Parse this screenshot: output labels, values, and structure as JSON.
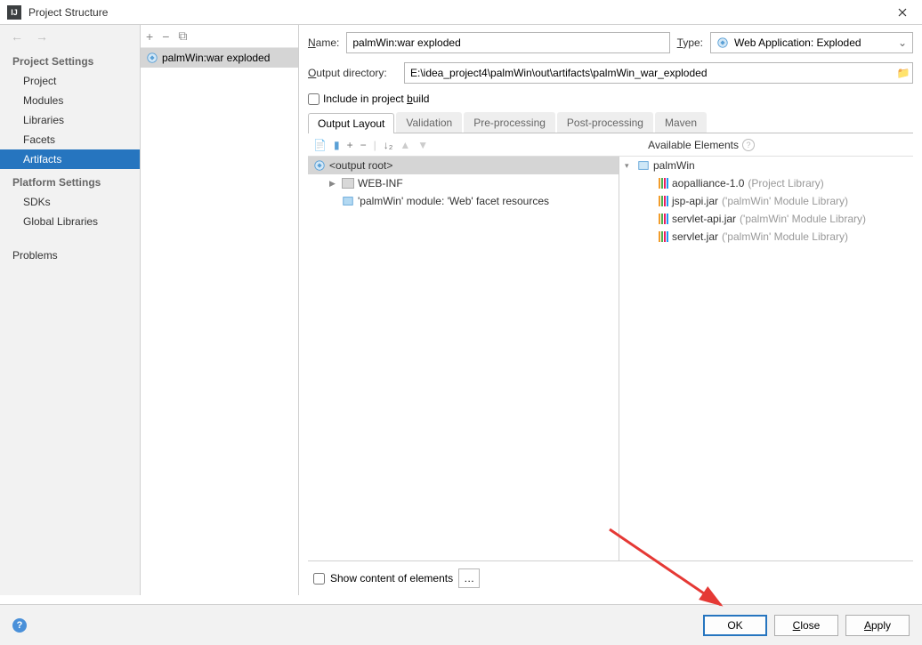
{
  "window": {
    "title": "Project Structure"
  },
  "sidebar": {
    "section1": "Project Settings",
    "section2": "Platform Settings",
    "items": [
      "Project",
      "Modules",
      "Libraries",
      "Facets",
      "Artifacts"
    ],
    "platform_items": [
      "SDKs",
      "Global Libraries"
    ],
    "problems": "Problems"
  },
  "artifact_list": {
    "entry": "palmWin:war exploded"
  },
  "form": {
    "name_label": "Name:",
    "name_value": "palmWin:war exploded",
    "type_label": "Type:",
    "type_value": "Web Application: Exploded",
    "outdir_label": "Output directory:",
    "outdir_value": "E:\\idea_project4\\palmWin\\out\\artifacts\\palmWin_war_exploded",
    "include_label": "Include in project build"
  },
  "tabs": [
    "Output Layout",
    "Validation",
    "Pre-processing",
    "Post-processing",
    "Maven"
  ],
  "output_tree": {
    "root": "<output root>",
    "webinf": "WEB-INF",
    "facet": "'palmWin' module: 'Web' facet resources"
  },
  "available": {
    "header": "Available Elements",
    "module": "palmWin",
    "libs": [
      {
        "name": "aopalliance-1.0",
        "scope": "(Project Library)"
      },
      {
        "name": "jsp-api.jar",
        "scope": "('palmWin' Module Library)"
      },
      {
        "name": "servlet-api.jar",
        "scope": "('palmWin' Module Library)"
      },
      {
        "name": "servlet.jar",
        "scope": "('palmWin' Module Library)"
      }
    ]
  },
  "show_content": "Show content of elements",
  "buttons": {
    "ok": "OK",
    "close": "Close",
    "apply": "Apply"
  }
}
